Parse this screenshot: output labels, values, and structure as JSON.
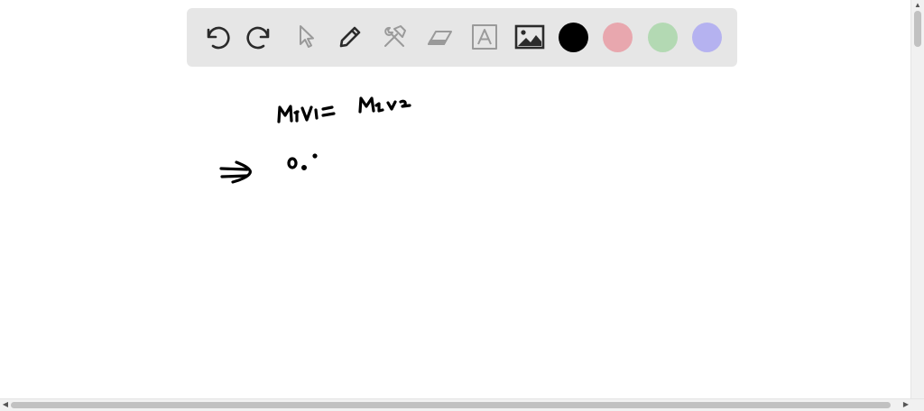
{
  "toolbar": {
    "tools": [
      {
        "name": "undo",
        "icon": "undo-icon",
        "enabled": true
      },
      {
        "name": "redo",
        "icon": "redo-icon",
        "enabled": true
      },
      {
        "name": "select",
        "icon": "pointer-icon",
        "enabled": false
      },
      {
        "name": "pen",
        "icon": "pencil-icon",
        "enabled": true
      },
      {
        "name": "tools",
        "icon": "hammer-wrench-icon",
        "enabled": false
      },
      {
        "name": "eraser",
        "icon": "eraser-icon",
        "enabled": false
      },
      {
        "name": "text",
        "icon": "text-box-icon",
        "enabled": false
      },
      {
        "name": "image",
        "icon": "image-icon",
        "enabled": true
      }
    ],
    "colors": [
      "#000000",
      "#e8a7ae",
      "#b3d9b3",
      "#b5b2f0"
    ],
    "selected_color": "#000000"
  },
  "whiteboard": {
    "handwritten_lines": [
      "M1V1 = M2V2",
      "⇒ 0."
    ]
  },
  "colors": {
    "toolbar_bg": "#e6e6e6",
    "icon_active": "#2b2b2b",
    "icon_disabled": "#9a9a9a"
  }
}
